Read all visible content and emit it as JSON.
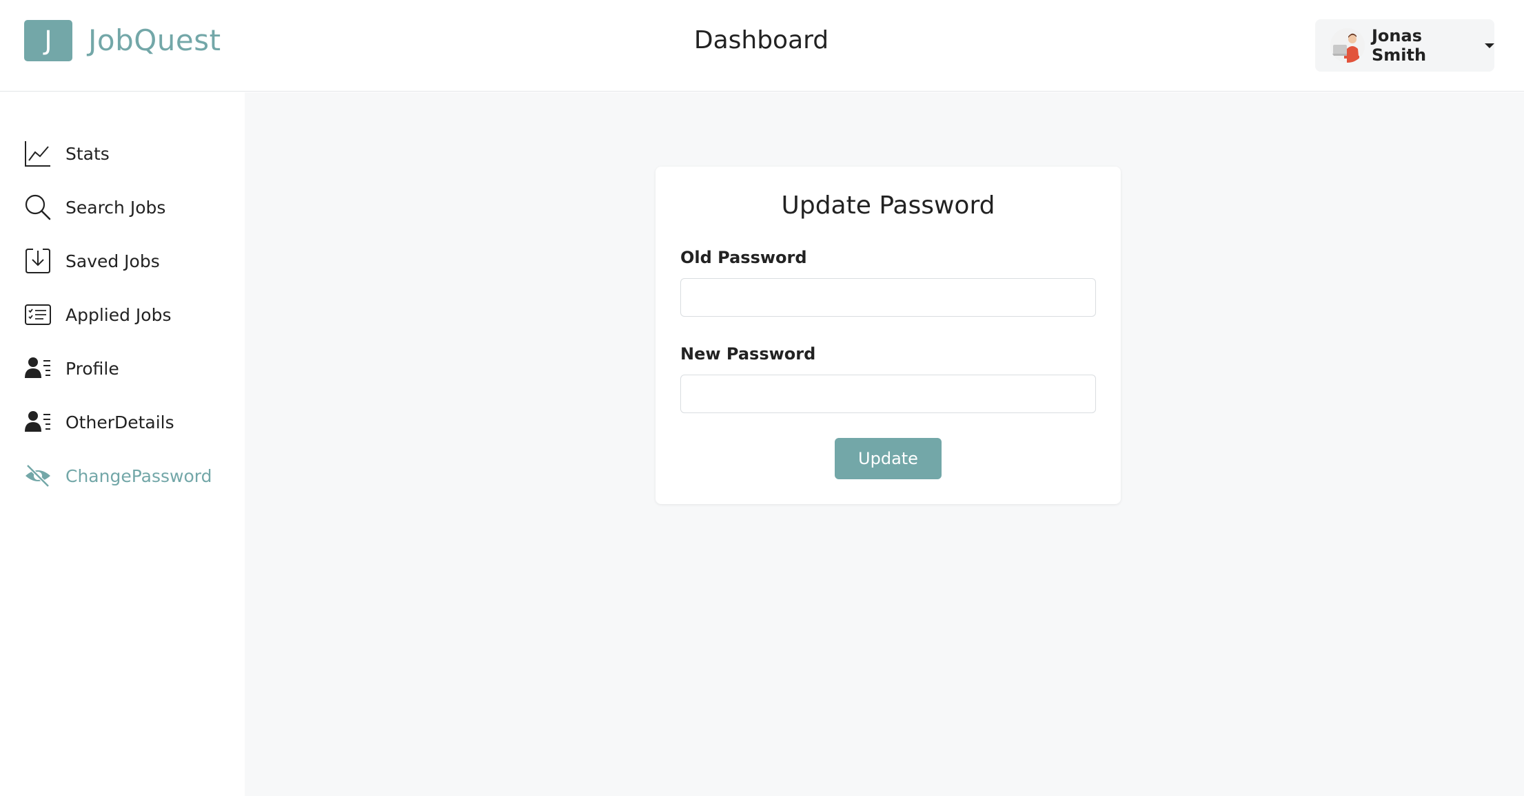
{
  "app": {
    "logo_letter": "J",
    "name": "JobQuest",
    "page_title": "Dashboard"
  },
  "user": {
    "name": "Jonas Smith"
  },
  "sidebar": {
    "items": [
      {
        "label": "Stats",
        "icon": "line-chart-icon"
      },
      {
        "label": "Search Jobs",
        "icon": "search-icon"
      },
      {
        "label": "Saved Jobs",
        "icon": "download-box-icon"
      },
      {
        "label": "Applied Jobs",
        "icon": "checklist-icon"
      },
      {
        "label": "Profile",
        "icon": "person-lines-icon"
      },
      {
        "label": "OtherDetails",
        "icon": "person-lines-icon"
      },
      {
        "label": "ChangePassword",
        "icon": "eye-slash-icon",
        "active": true
      }
    ]
  },
  "form": {
    "title": "Update Password",
    "old_password_label": "Old Password",
    "old_password_value": "",
    "new_password_label": "New Password",
    "new_password_value": "",
    "submit_label": "Update"
  },
  "colors": {
    "accent": "#73a7a8",
    "main_background": "#f7f8f9",
    "text": "#222222"
  }
}
